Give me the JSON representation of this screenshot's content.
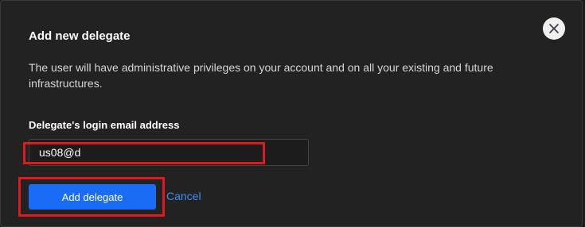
{
  "dialog": {
    "title": "Add new delegate",
    "description": "The user will have administrative privileges on your account and on all your existing and future infrastructures.",
    "close_icon": "close-icon"
  },
  "form": {
    "email_label": "Delegate's login email address",
    "email_value": "us08@d"
  },
  "actions": {
    "submit_label": "Add delegate",
    "cancel_label": "Cancel"
  },
  "colors": {
    "accent": "#1a6cf6",
    "link": "#3d8bf7",
    "highlight": "#e0191f",
    "background": "#222222"
  }
}
